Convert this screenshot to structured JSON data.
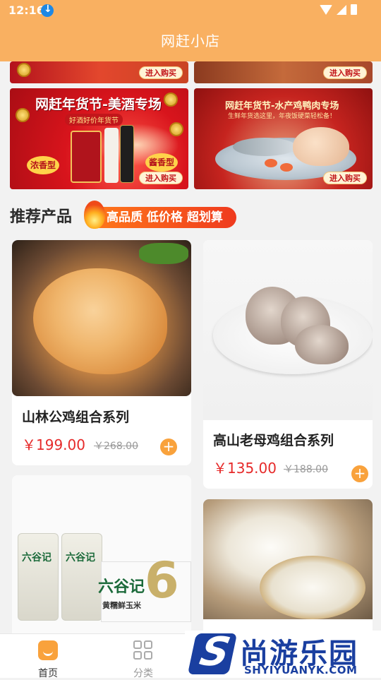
{
  "status_bar": {
    "time": "12:16"
  },
  "header": {
    "title": "网赶小店"
  },
  "banners": {
    "top_left_button": "进入购买",
    "top_right_button": "进入购买",
    "wine": {
      "title": "网赶年货节-美酒专场",
      "subtitle": "好酒好价年货节",
      "stamp_left": "浓香型",
      "stamp_right": "酱香型",
      "button": "进入购买"
    },
    "poultry": {
      "title": "网赶年货节-水产鸡鸭肉专场",
      "subtitle": "生鲜年货选这里，年夜饭硬菜轻松备！",
      "button": "进入购买"
    }
  },
  "recommend": {
    "title": "推荐产品",
    "promo": "高品质 低价格 超划算"
  },
  "products": [
    {
      "name": "山林公鸡组合系列",
      "price": "￥199.00",
      "old_price": "￥268.00"
    },
    {
      "name": "高山老母鸡组合系列",
      "price": "￥135.00",
      "old_price": "￥188.00"
    }
  ],
  "product_3_brand": "六谷记",
  "product_3_brand_sub": "黄糯鲜玉米",
  "nav": {
    "home": "首页",
    "category": "分类"
  },
  "watermark": {
    "cn": "尚游乐园",
    "url": "SHYIYUANYK.COM"
  },
  "colors": {
    "header_bg": "#f9b061",
    "price": "#e62a2a",
    "accent": "#f9a23c"
  }
}
